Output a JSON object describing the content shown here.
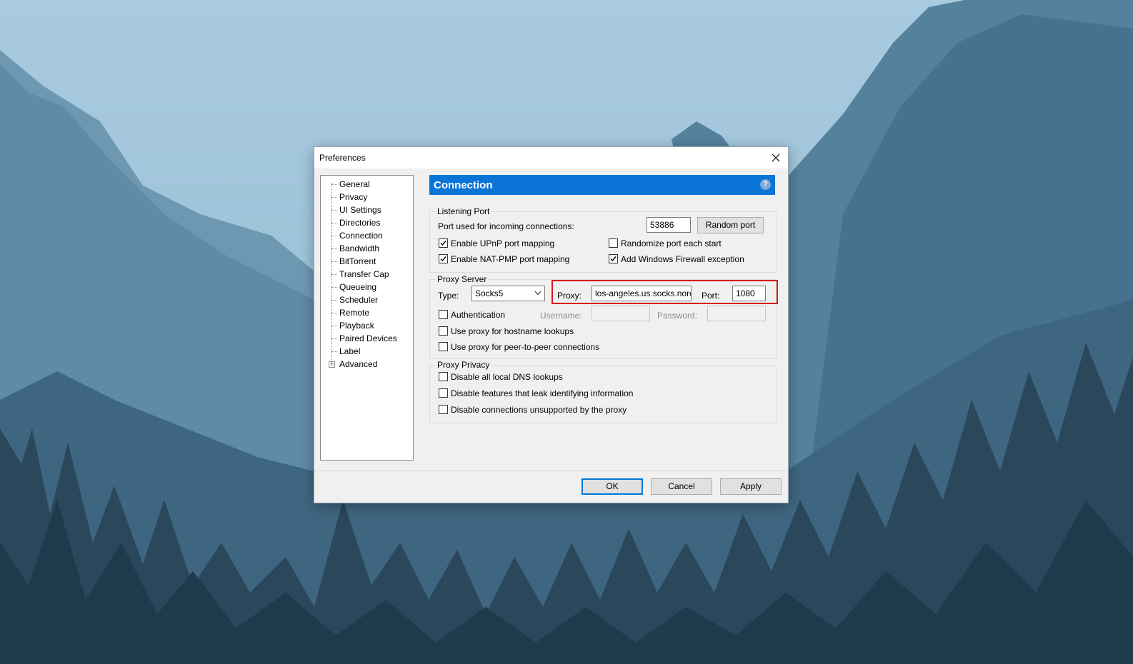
{
  "dialog": {
    "title": "Preferences"
  },
  "tree": {
    "items": [
      "General",
      "Privacy",
      "UI Settings",
      "Directories",
      "Connection",
      "Bandwidth",
      "BitTorrent",
      "Transfer Cap",
      "Queueing",
      "Scheduler",
      "Remote",
      "Playback",
      "Paired Devices",
      "Label",
      "Advanced"
    ],
    "selected": "Connection"
  },
  "panel": {
    "title": "Connection"
  },
  "listening": {
    "group_label": "Listening Port",
    "port_label": "Port used for incoming connections:",
    "port_value": "53886",
    "random_button": "Random port",
    "upnp": {
      "label": "Enable UPnP port mapping",
      "checked": true
    },
    "natpmp": {
      "label": "Enable NAT-PMP port mapping",
      "checked": true
    },
    "randomize": {
      "label": "Randomize port each start",
      "checked": false
    },
    "firewall": {
      "label": "Add Windows Firewall exception",
      "checked": true
    }
  },
  "proxy": {
    "group_label": "Proxy Server",
    "type_label": "Type:",
    "type_value": "Socks5",
    "proxy_label": "Proxy:",
    "proxy_value": "los-angeles.us.socks.norc",
    "port_label": "Port:",
    "port_value": "1080",
    "auth": {
      "label": "Authentication",
      "checked": false
    },
    "username_label": "Username:",
    "password_label": "Password:",
    "hostname": {
      "label": "Use proxy for hostname lookups",
      "checked": false
    },
    "p2p": {
      "label": "Use proxy for peer-to-peer connections",
      "checked": false
    }
  },
  "privacy": {
    "group_label": "Proxy Privacy",
    "dns": {
      "label": "Disable all local DNS lookups",
      "checked": false
    },
    "leak": {
      "label": "Disable features that leak identifying information",
      "checked": false
    },
    "unsupported": {
      "label": "Disable connections unsupported by the proxy",
      "checked": false
    }
  },
  "buttons": {
    "ok": "OK",
    "cancel": "Cancel",
    "apply": "Apply"
  },
  "colors": {
    "header": "#0a74d7",
    "highlight": "#d41c1c",
    "default_button_border": "#0078d7"
  },
  "icons": {
    "close": "close-icon",
    "help": "help-icon",
    "dropdown": "chevron-down-icon",
    "expander": "plus-icon",
    "check": "checkmark-icon"
  }
}
